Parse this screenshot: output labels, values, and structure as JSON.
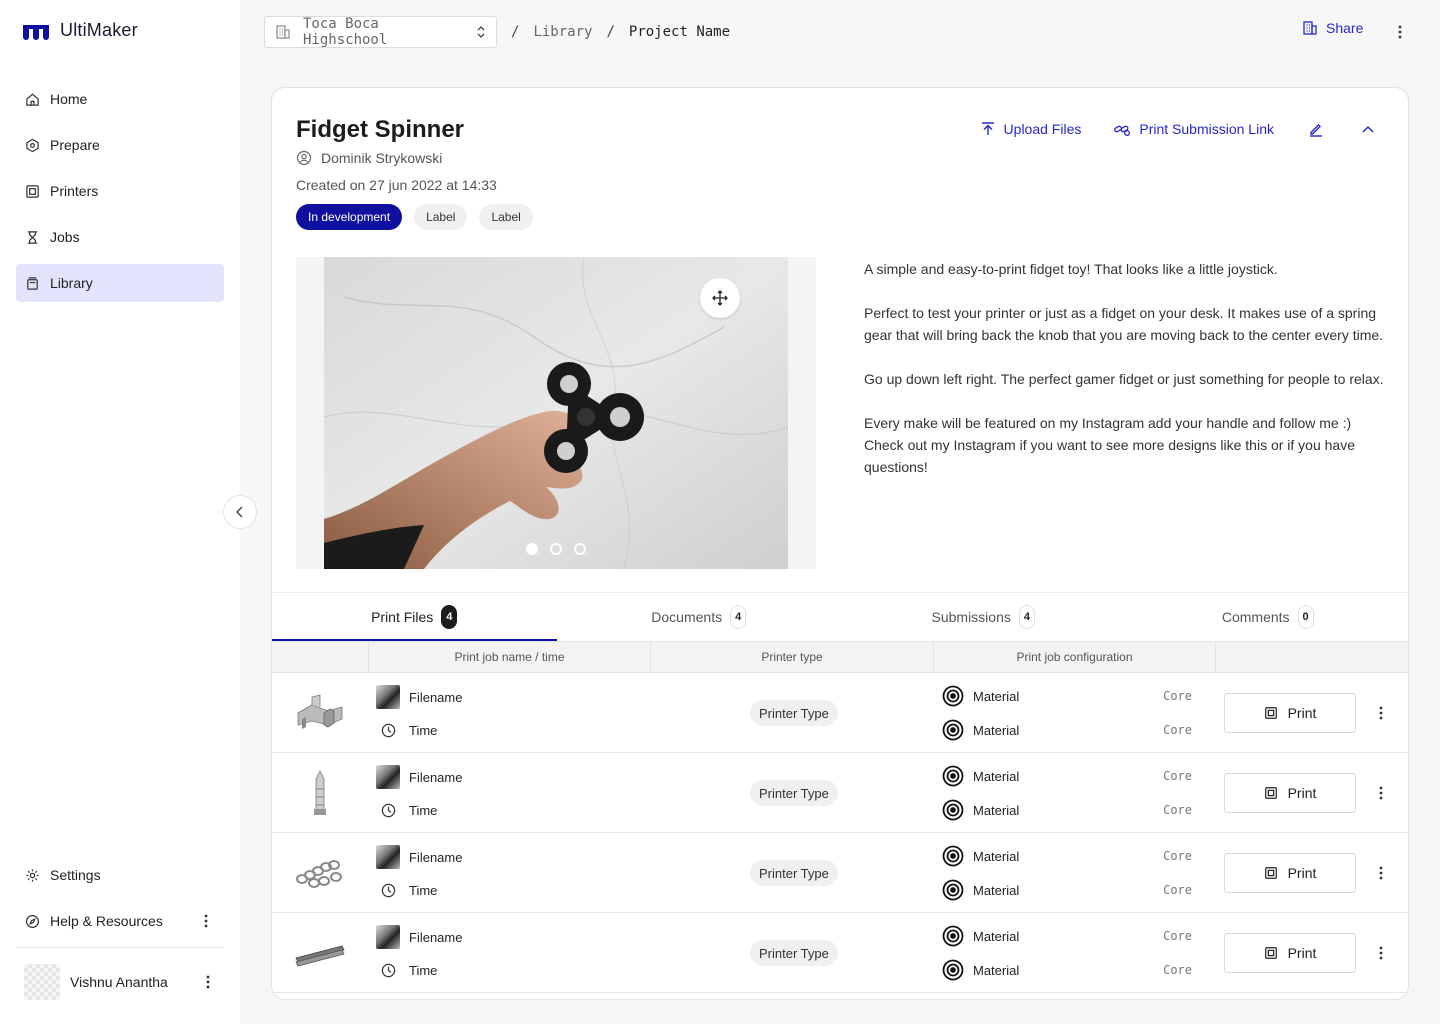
{
  "app": {
    "name": "UltiMaker",
    "brand_color": "#1010a0",
    "link_color": "#2727c9"
  },
  "sidebar": {
    "items": [
      {
        "label": "Home",
        "icon": "home-icon"
      },
      {
        "label": "Prepare",
        "icon": "hexagon-icon"
      },
      {
        "label": "Printers",
        "icon": "printer-icon"
      },
      {
        "label": "Jobs",
        "icon": "jobs-icon"
      },
      {
        "label": "Library",
        "icon": "library-icon",
        "active": true
      }
    ],
    "bottom": [
      {
        "label": "Settings",
        "icon": "gear-icon"
      },
      {
        "label": "Help & Resources",
        "icon": "compass-icon"
      }
    ],
    "user": {
      "name": "Vishnu Anantha"
    }
  },
  "topbar": {
    "org": "Toca Boca Highschool",
    "breadcrumb": [
      "Library",
      "Project Name"
    ],
    "share_label": "Share"
  },
  "project": {
    "title": "Fidget Spinner",
    "author": "Dominik Strykowski",
    "created": "Created on 27 jun 2022 at 14:33",
    "badges": [
      "In development",
      "Label",
      "Label"
    ],
    "actions": {
      "upload": "Upload Files",
      "submission": "Print Submission Link"
    },
    "description": [
      "A simple and easy-to-print fidget toy! That looks like a little joystick.",
      "Perfect to test your printer or just as a fidget on your desk. It makes use of a spring gear that will bring back the knob that you are moving back to the center every time.",
      "Go up down left right. The perfect gamer fidget or just something for people to relax.",
      "Every make will be featured on my Instagram add your handle and follow me :) Check out my Instagram if you want to see more designs like this or if you have questions!"
    ],
    "carousel": {
      "count": 3,
      "active": 0
    }
  },
  "tabs": [
    {
      "label": "Print Files",
      "count": "4"
    },
    {
      "label": "Documents",
      "count": "4"
    },
    {
      "label": "Submissions",
      "count": "4"
    },
    {
      "label": "Comments",
      "count": "0"
    }
  ],
  "table": {
    "headers": [
      "",
      "Print job name / time",
      "Printer type",
      "Print job configuration",
      ""
    ],
    "rows": [
      {
        "thumb": "block-model-icon",
        "filename": "Filename",
        "time": "Time",
        "printer_type": "Printer Type",
        "material1": "Material",
        "core1": "Core",
        "material2": "Material",
        "core2": "Core",
        "print_label": "Print"
      },
      {
        "thumb": "tower-model-icon",
        "filename": "Filename",
        "time": "Time",
        "printer_type": "Printer Type",
        "material1": "Material",
        "core1": "Core",
        "material2": "Material",
        "core2": "Core",
        "print_label": "Print"
      },
      {
        "thumb": "chain-model-icon",
        "filename": "Filename",
        "time": "Time",
        "printer_type": "Printer Type",
        "material1": "Material",
        "core1": "Core",
        "material2": "Material",
        "core2": "Core",
        "print_label": "Print"
      },
      {
        "thumb": "rod-model-icon",
        "filename": "Filename",
        "time": "Time",
        "printer_type": "Printer Type",
        "material1": "Material",
        "core1": "Core",
        "material2": "Material",
        "core2": "Core",
        "print_label": "Print"
      }
    ]
  }
}
